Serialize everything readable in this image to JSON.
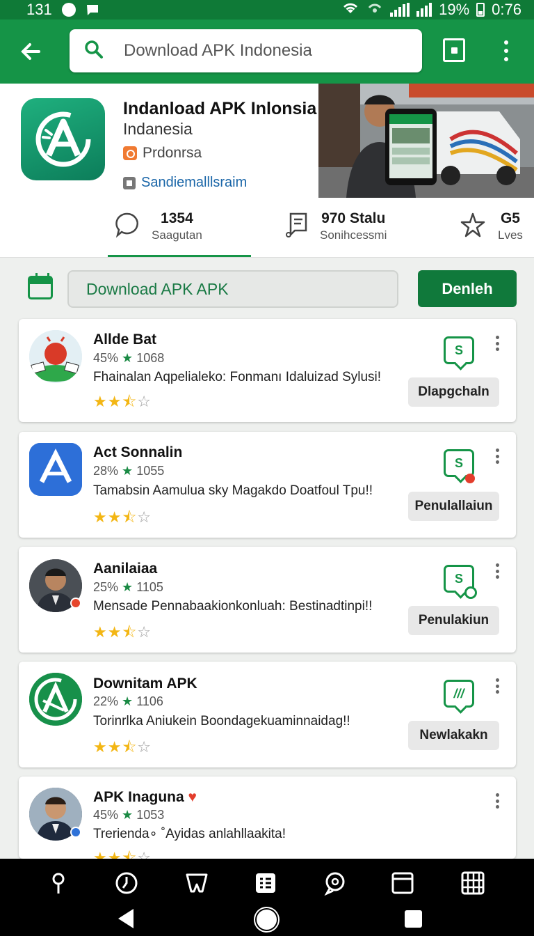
{
  "status_bar": {
    "time_left": "131",
    "battery": "19%",
    "clock": "0:76"
  },
  "search": {
    "value": "Download APK Indonesia"
  },
  "app": {
    "title": "Indanload APK Inlonsia",
    "subtitle": "Indanesia",
    "publisher": "Prdonrsa",
    "developer": "Sandiemalllsraim"
  },
  "stats": [
    {
      "value": "1354",
      "label": "Saagutan"
    },
    {
      "value": "970 Stalu",
      "label": "Sonihcessmi"
    },
    {
      "value": "G5",
      "label": "Lves"
    }
  ],
  "filter": {
    "value": "Download APK APK",
    "button": "Denleh"
  },
  "colors": {
    "primary": "#159447",
    "primary_dark": "#0f7a37",
    "star": "#f3b614"
  },
  "list": [
    {
      "name": "Allde Bat",
      "percent": "45%",
      "star": "★",
      "count": "1068",
      "desc": "Fhainalan Aqpelialeko: Fonmanı Idaluizad Sylusi!",
      "rating": 2.5,
      "button": "Dlapgchaln",
      "icon": "apk-mascot-icon"
    },
    {
      "name": "Act Sonnalin",
      "percent": "28%",
      "star": "★",
      "count": "1055",
      "desc": "Tamabsin Aamulua sky Magakdo Doatfoul Tpu!!",
      "rating": 2.5,
      "button": "Penulallaiun",
      "icon": "app-store-icon"
    },
    {
      "name": "Aanilaiaa",
      "percent": "25%",
      "star": "★",
      "count": "1105",
      "desc": "Mensade Pennabaakionkonluah: Bestinadtinpi!!",
      "rating": 2.5,
      "button": "Penulakiun",
      "icon": "person-avatar"
    },
    {
      "name": "Downitam APK",
      "percent": "22%",
      "star": "★",
      "count": "1106",
      "desc": "Torinrlka Aniukein Boondagekuaminnaidag!!",
      "rating": 2.5,
      "button": "Newlakakn",
      "icon": "downitam-logo-icon"
    },
    {
      "name": "APK Inaguna",
      "percent": "45%",
      "star": "★",
      "count": "1053",
      "desc": "Trerienda∘ ˚Ayidas anlahllaakita!",
      "rating": 2.5,
      "button": "",
      "icon": "person-avatar"
    }
  ],
  "action_glyphs": [
    "S",
    "S",
    "S",
    "///",
    ""
  ],
  "bottom_nav": [
    "location-pin-icon",
    "clock-icon",
    "tooth-icon",
    "list-icon",
    "chat-icon",
    "archive-icon",
    "grid-icon"
  ]
}
